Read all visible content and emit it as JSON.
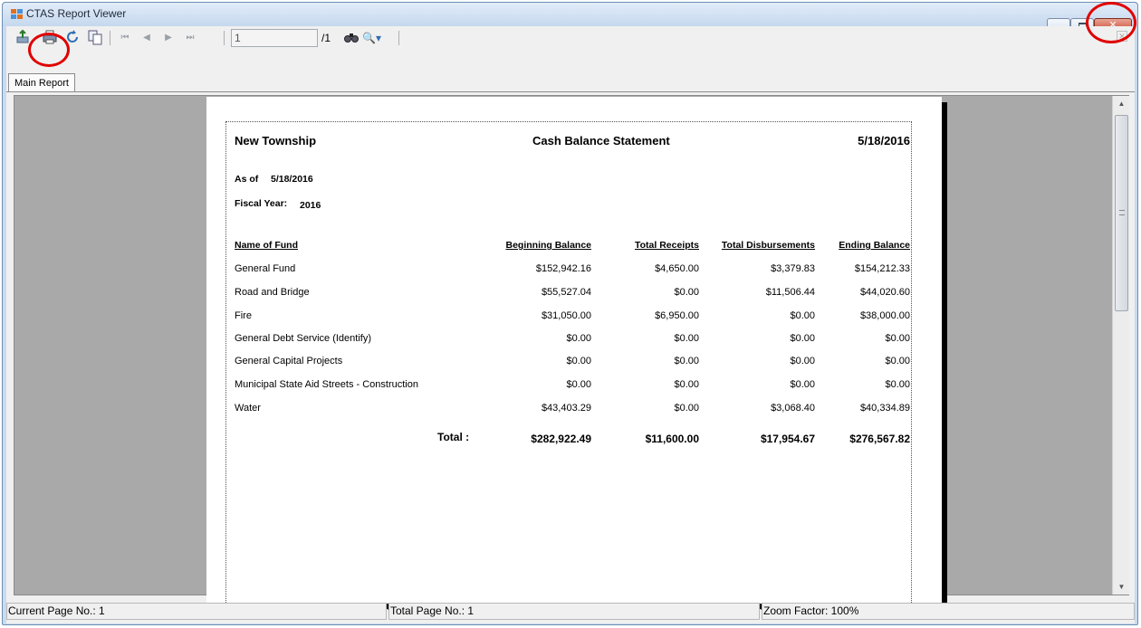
{
  "window": {
    "title": "CTAS Report Viewer",
    "minimize_glyph": "",
    "close_glyph": "✕"
  },
  "toolbar": {
    "page_number": "1",
    "page_total": "/1",
    "zoom_label": "🔍▾"
  },
  "tab": {
    "label": "Main Report"
  },
  "report": {
    "township": "New Township",
    "statement_title": "Cash Balance Statement",
    "date": "5/18/2016",
    "as_of_label": "As of",
    "as_of_date": "5/18/2016",
    "fiscal_year_label": "Fiscal Year:",
    "fiscal_year": "2016",
    "columns": {
      "name": "Name of Fund",
      "beginning": "Beginning Balance",
      "receipts": "Total Receipts",
      "disbursements": "Total Disbursements",
      "ending": "Ending Balance"
    },
    "rows": [
      {
        "name": "General Fund",
        "beginning": "$152,942.16",
        "receipts": "$4,650.00",
        "disbursements": "$3,379.83",
        "ending": "$154,212.33"
      },
      {
        "name": "Road and Bridge",
        "beginning": "$55,527.04",
        "receipts": "$0.00",
        "disbursements": "$11,506.44",
        "ending": "$44,020.60"
      },
      {
        "name": "Fire",
        "beginning": "$31,050.00",
        "receipts": "$6,950.00",
        "disbursements": "$0.00",
        "ending": "$38,000.00"
      },
      {
        "name": "General Debt Service (Identify)",
        "beginning": "$0.00",
        "receipts": "$0.00",
        "disbursements": "$0.00",
        "ending": "$0.00"
      },
      {
        "name": "General Capital Projects",
        "beginning": "$0.00",
        "receipts": "$0.00",
        "disbursements": "$0.00",
        "ending": "$0.00"
      },
      {
        "name": "Municipal State Aid Streets - Construction",
        "beginning": "$0.00",
        "receipts": "$0.00",
        "disbursements": "$0.00",
        "ending": "$0.00"
      },
      {
        "name": "Water",
        "beginning": "$43,403.29",
        "receipts": "$0.00",
        "disbursements": "$3,068.40",
        "ending": "$40,334.89"
      }
    ],
    "total": {
      "label": "Total :",
      "beginning": "$282,922.49",
      "receipts": "$11,600.00",
      "disbursements": "$17,954.67",
      "ending": "$276,567.82"
    }
  },
  "status": {
    "current_page": "Current Page No.: 1",
    "total_pages": "Total Page No.: 1",
    "zoom": "Zoom Factor: 100%"
  },
  "colors": {
    "annotation_ring": "#e00000",
    "viewer_background": "#a9a9a9",
    "close_button": "#c9442c"
  }
}
